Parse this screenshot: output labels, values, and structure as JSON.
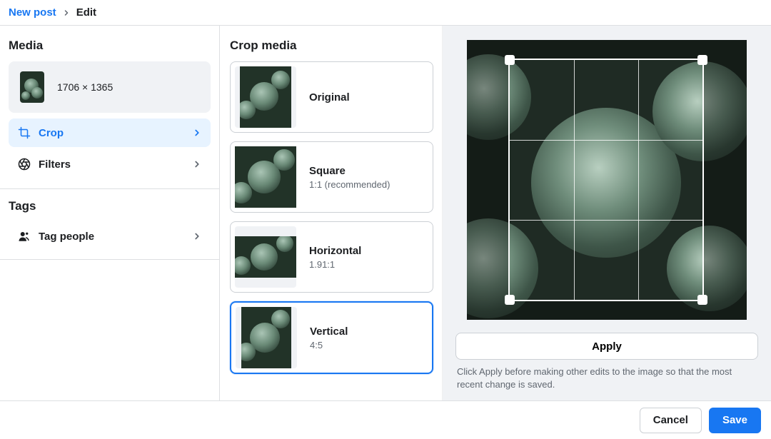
{
  "breadcrumb": {
    "parent": "New post",
    "current": "Edit"
  },
  "sidebar": {
    "media_title": "Media",
    "media_dimensions": "1706 × 1365",
    "crop_label": "Crop",
    "filters_label": "Filters",
    "tags_title": "Tags",
    "tag_people_label": "Tag people"
  },
  "crop": {
    "title": "Crop media",
    "options": [
      {
        "label": "Original",
        "sub": ""
      },
      {
        "label": "Square",
        "sub": "1:1 (recommended)"
      },
      {
        "label": "Horizontal",
        "sub": "1.91:1"
      },
      {
        "label": "Vertical",
        "sub": "4:5"
      }
    ],
    "apply_label": "Apply",
    "hint": "Click Apply before making other edits to the image so that the most recent change is saved."
  },
  "footer": {
    "cancel": "Cancel",
    "save": "Save"
  },
  "colors": {
    "accent": "#1877f2"
  }
}
